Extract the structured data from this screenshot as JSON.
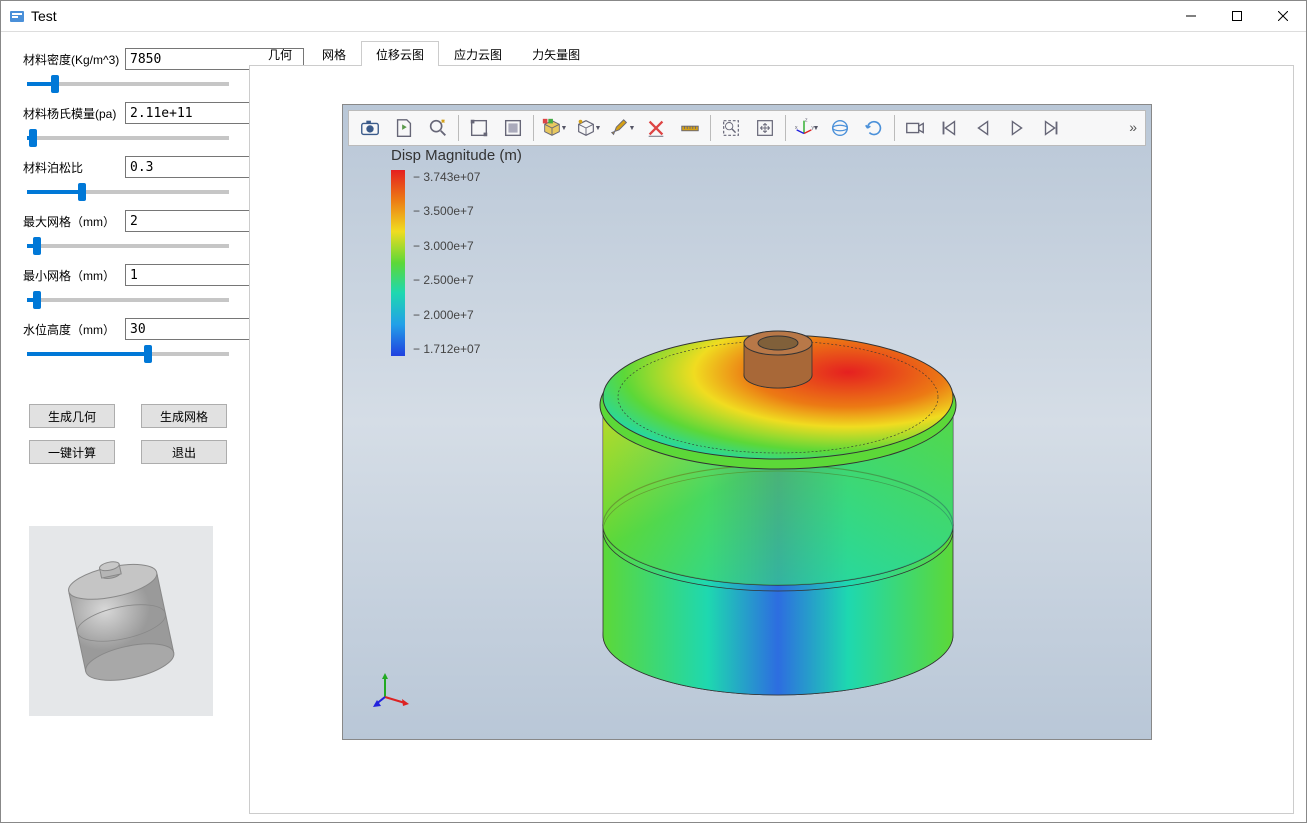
{
  "window": {
    "title": "Test"
  },
  "sidebar": {
    "fields": [
      {
        "label": "材料密度(Kg/m^3)",
        "value": "7850",
        "slider_pct": 14
      },
      {
        "label": "材料杨氏模量(pa)",
        "value": "2.11e+11",
        "slider_pct": 3
      },
      {
        "label": "材料泊松比",
        "value": "0.3",
        "slider_pct": 27
      },
      {
        "label": "最大网格（mm）",
        "value": "2",
        "slider_pct": 5
      },
      {
        "label": "最小网格（mm）",
        "value": "1",
        "slider_pct": 5
      },
      {
        "label": "水位高度（mm）",
        "value": "30",
        "slider_pct": 60
      }
    ],
    "buttons": {
      "gen_geom": "生成几何",
      "gen_mesh": "生成网格",
      "one_click_calc": "一键计算",
      "exit": "退出"
    }
  },
  "tabs": {
    "items": [
      "几何",
      "网格",
      "位移云图",
      "应力云图",
      "力矢量图"
    ],
    "active_index": 2
  },
  "legend": {
    "title": "Disp Magnitude (m)",
    "ticks": [
      "3.743e+07",
      "3.500e+7",
      "3.000e+7",
      "2.500e+7",
      "2.000e+7",
      "1.712e+07"
    ]
  },
  "toolbar": {
    "overflow": "»"
  }
}
